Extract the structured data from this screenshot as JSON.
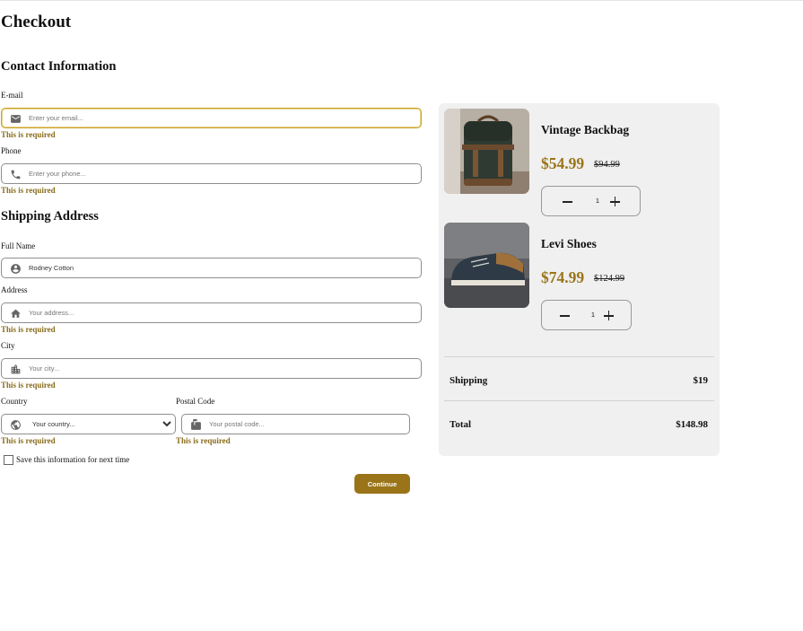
{
  "page": {
    "title": "Checkout"
  },
  "contact": {
    "heading": "Contact Information",
    "email": {
      "label": "E-mail",
      "placeholder": "Enter your email...",
      "error": "This is required"
    },
    "phone": {
      "label": "Phone",
      "placeholder": "Enter your phone...",
      "error": "This is required"
    }
  },
  "shipping": {
    "heading": "Shipping Address",
    "full_name": {
      "label": "Full Name",
      "value": "Rodney Cotton"
    },
    "address": {
      "label": "Address",
      "placeholder": "Your address...",
      "error": "This is required"
    },
    "city": {
      "label": "City",
      "placeholder": "Your city...",
      "error": "This is required"
    },
    "country": {
      "label": "Country",
      "selected": "Your country...",
      "error": "This is required"
    },
    "postal": {
      "label": "Postal Code",
      "placeholder": "Your postal code...",
      "error": "This is required"
    }
  },
  "save_info": {
    "label": "Save this information for next time",
    "checked": false
  },
  "continue_label": "Continue",
  "cart": {
    "items": [
      {
        "name": "Vintage Backbag",
        "price": "$54.99",
        "old_price": "$94.99",
        "qty": "1"
      },
      {
        "name": "Levi Shoes",
        "price": "$74.99",
        "old_price": "$124.99",
        "qty": "1"
      }
    ],
    "shipping_label": "Shipping",
    "shipping_value": "$19",
    "total_label": "Total",
    "total_value": "$148.98"
  },
  "colors": {
    "accent": "#9a7418",
    "error": "#8a6d1d",
    "cart_bg": "#f0f0f0"
  },
  "icons": [
    "mail-icon",
    "phone-icon",
    "account-circle-icon",
    "home-icon",
    "city-icon",
    "globe-icon",
    "mailbox-icon",
    "minus-icon",
    "plus-icon"
  ]
}
